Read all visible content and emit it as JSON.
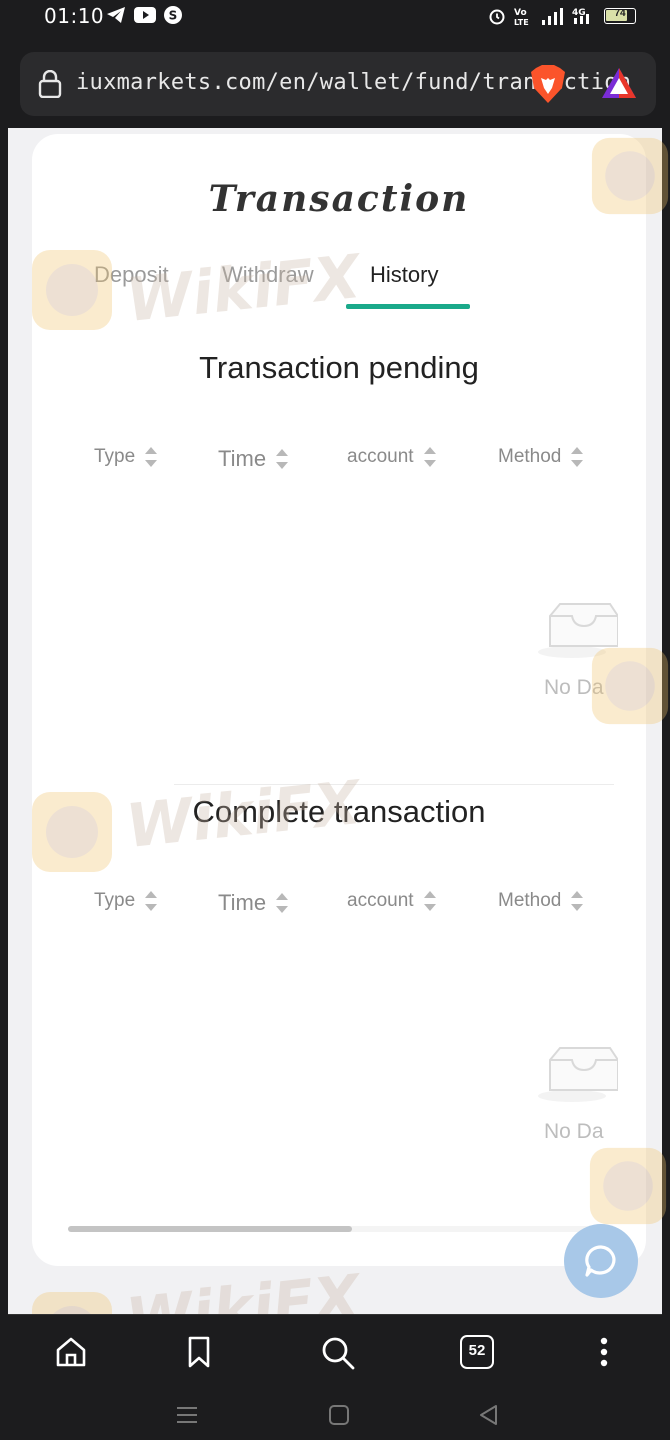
{
  "status_bar": {
    "time": "01:10",
    "battery": "74"
  },
  "browser": {
    "url": "iuxmarkets.com/en/wallet/fund/transaction",
    "tab_count": "52"
  },
  "page": {
    "title": "Transaction",
    "tabs": [
      {
        "label": "Deposit",
        "active": false
      },
      {
        "label": "Withdraw",
        "active": false
      },
      {
        "label": "History",
        "active": true
      }
    ],
    "pending": {
      "title": "Transaction pending",
      "columns": [
        "Type",
        "Time",
        "account",
        "Method"
      ],
      "empty_text": "No Da"
    },
    "complete": {
      "title": "Complete transaction",
      "columns": [
        "Type",
        "Time",
        "account",
        "Method"
      ],
      "empty_text": "No Da"
    }
  },
  "watermark": {
    "text": "WikiFX"
  },
  "colors": {
    "accent": "#1aa98a",
    "chat_button": "#a8c8e8"
  },
  "icons": {
    "status": [
      "telegram-icon",
      "youtube-icon",
      "s-app-icon",
      "alarm-icon",
      "volte-icon",
      "signal-icon",
      "4g-icon",
      "battery-icon"
    ],
    "browser": [
      "lock-icon",
      "brave-lion-icon",
      "brave-rewards-icon"
    ],
    "bottom": [
      "home-icon",
      "bookmark-icon",
      "search-icon",
      "tabs-icon",
      "more-icon"
    ],
    "nav": [
      "menu-icon",
      "home-square-icon",
      "back-icon"
    ]
  }
}
